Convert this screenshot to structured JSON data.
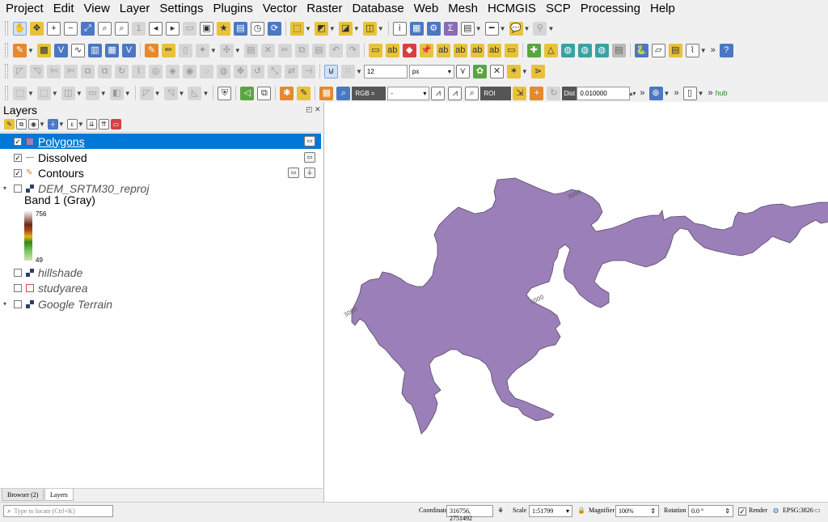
{
  "menu": [
    "Project",
    "Edit",
    "View",
    "Layer",
    "Settings",
    "Plugins",
    "Vector",
    "Raster",
    "Database",
    "Web",
    "Mesh",
    "HCMGIS",
    "SCP",
    "Processing",
    "Help"
  ],
  "toolbar": {
    "snap_tolerance": "12",
    "snap_unit": "px",
    "scp_band_set": "RGB =",
    "scp_rgb_combo": "-",
    "scp_roi_label": "ROI",
    "scp_dist_label": "Dist",
    "scp_dist_value": "0.010000",
    "cut_plugin_label": "hub"
  },
  "layers_panel": {
    "title": "Layers",
    "layers": [
      {
        "name": "Polygons",
        "checked": true,
        "selected": true,
        "symbol": "polygon-fill",
        "color": "#9b7fb8"
      },
      {
        "name": "Dissolved",
        "checked": true,
        "symbol": "line",
        "color": "#9a9a9a"
      },
      {
        "name": "Contours",
        "checked": true,
        "symbol": "line-pen",
        "color": "#e57f1f"
      },
      {
        "name": "DEM_SRTM30_reproj",
        "checked": false,
        "symbol": "raster",
        "italic": true,
        "expanded": true
      },
      {
        "name": "hillshade",
        "checked": false,
        "symbol": "raster",
        "italic": true
      },
      {
        "name": "studyarea",
        "checked": false,
        "symbol": "polygon-outline",
        "italic": true,
        "color": "#d04b4b"
      },
      {
        "name": "Google Terrain",
        "checked": false,
        "symbol": "raster",
        "italic": true,
        "expanded": true
      }
    ],
    "legend": {
      "band": "Band 1 (Gray)",
      "max": "756",
      "min": "49"
    },
    "tabs": [
      "Browser (2)",
      "Layers"
    ]
  },
  "map": {
    "polygon_fill": "#9b7fb8",
    "polygon_stroke": "#5a4a6a",
    "contour_labels": [
      "3000",
      "3000",
      "3000"
    ]
  },
  "statusbar": {
    "locate_placeholder": "Type to locate (Ctrl+K)",
    "coordinate_label": "Coordinate",
    "coordinate": "316756, 2751492",
    "scale_label": "Scale",
    "scale": "1:51799",
    "magnifier_label": "Magnifier",
    "magnifier": "100%",
    "rotation_label": "Rotation",
    "rotation": "0.0 °",
    "render_label": "Render",
    "crs": "EPSG:3826"
  }
}
